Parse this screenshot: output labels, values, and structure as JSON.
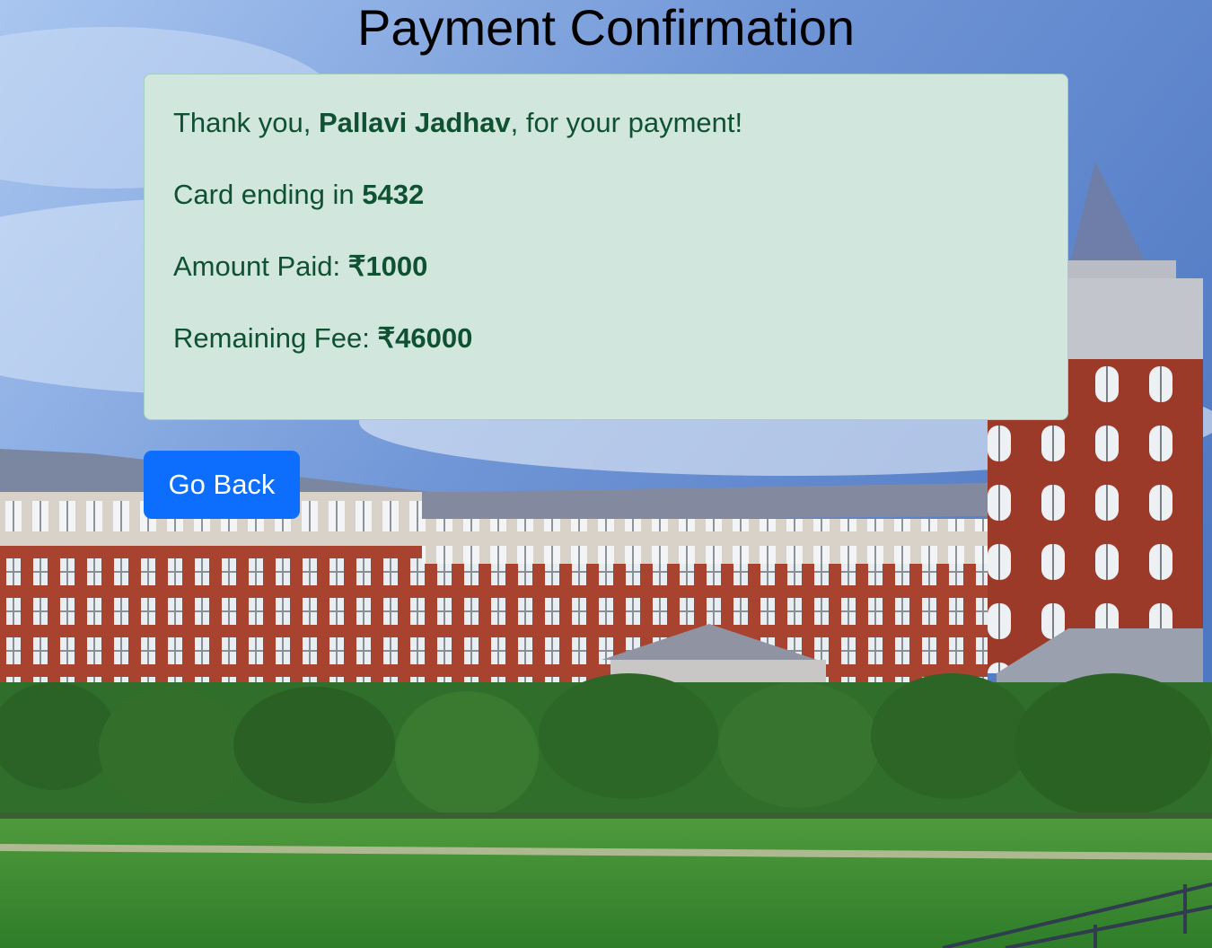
{
  "page": {
    "title": "Payment Confirmation"
  },
  "confirmation": {
    "thanks_prefix": "Thank you, ",
    "student_name": "Pallavi Jadhav",
    "thanks_suffix": ", for your payment!",
    "card_label": "Card ending in ",
    "card_last4": "5432",
    "amount_label": "Amount Paid: ",
    "amount_paid": "₹1000",
    "remaining_label": "Remaining Fee: ",
    "remaining_fee": "₹46000"
  },
  "actions": {
    "back_label": "Go Back"
  },
  "colors": {
    "alert_bg": "#d1e7dd",
    "alert_text": "#0f5132",
    "button_bg": "#0d6efd"
  }
}
